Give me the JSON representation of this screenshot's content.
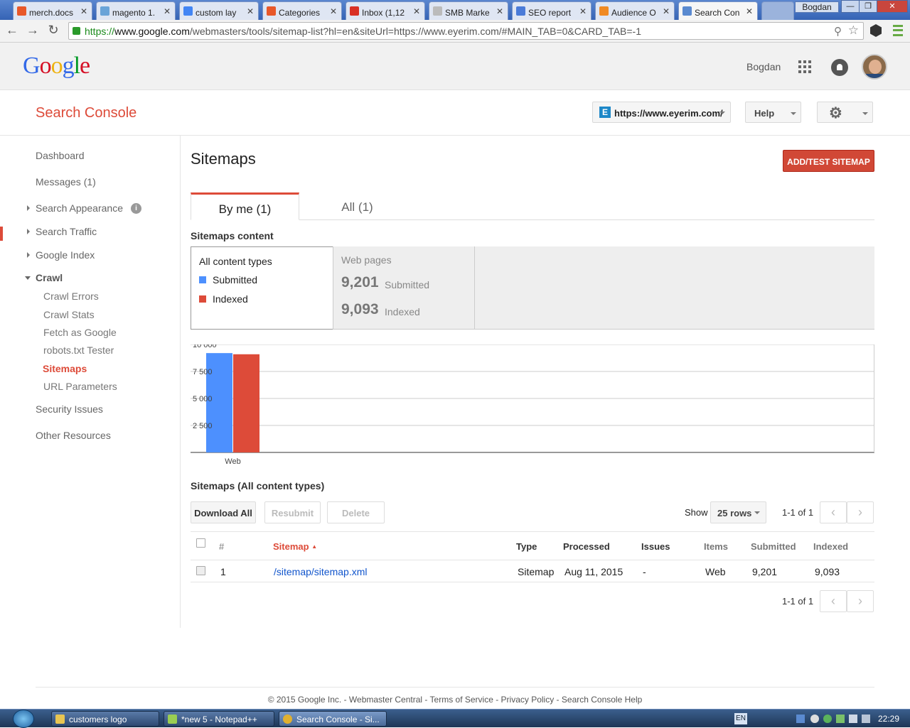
{
  "browser": {
    "tabs": [
      {
        "title": "merch.docs",
        "icon": "magento-icon",
        "color": "#e8582a"
      },
      {
        "title": "magento 1.",
        "icon": "magento-answers-icon",
        "color": "#6aa4d8"
      },
      {
        "title": "custom lay",
        "icon": "google-search-icon",
        "color": "#4285f4"
      },
      {
        "title": "Categories",
        "icon": "magento-icon",
        "color": "#e8582a"
      },
      {
        "title": "Inbox (1,12",
        "icon": "gmail-icon",
        "color": "#d93025"
      },
      {
        "title": "SMB Marke",
        "icon": "document-icon",
        "color": "#888888"
      },
      {
        "title": "SEO report",
        "icon": "google-docs-icon",
        "color": "#4a7bd8"
      },
      {
        "title": "Audience O",
        "icon": "analytics-icon",
        "color": "#f08a24"
      },
      {
        "title": "Search Con",
        "icon": "search-console-icon",
        "color": "#5a8ad0"
      }
    ],
    "window_user": "Bogdan",
    "window_controls": [
      "—",
      "❐",
      "✕"
    ],
    "url": {
      "scheme": "https://",
      "domain": "www.google.com",
      "path": "/webmasters/tools/sitemap-list?hl=en&siteUrl=https://www.eyerim.com/#MAIN_TAB=0&CARD_TAB=-1"
    },
    "nav_icons": [
      "back-icon",
      "forward-icon",
      "reload-icon"
    ]
  },
  "google_header": {
    "logo": "Google",
    "logo_colors": [
      "#3369e8",
      "#d50f25",
      "#eeb211",
      "#3369e8",
      "#009925",
      "#d50f25"
    ],
    "user_name": "Bogdan"
  },
  "console": {
    "title": "Search Console",
    "property": "https://www.eyerim.com/",
    "property_badge": "E",
    "help_label": "Help"
  },
  "sidebar": {
    "items": [
      {
        "label": "Dashboard"
      },
      {
        "label": "Messages (1)"
      },
      {
        "label": "Search Appearance"
      },
      {
        "label": "Search Traffic"
      },
      {
        "label": "Google Index"
      },
      {
        "label": "Crawl"
      },
      {
        "label": "Crawl Errors"
      },
      {
        "label": "Crawl Stats"
      },
      {
        "label": "Fetch as Google"
      },
      {
        "label": "robots.txt Tester"
      },
      {
        "label": "Sitemaps"
      },
      {
        "label": "URL Parameters"
      },
      {
        "label": "Security Issues"
      },
      {
        "label": "Other Resources"
      }
    ],
    "info_icon": "i"
  },
  "main": {
    "page_title": "Sitemaps",
    "add_button": "ADD/TEST SITEMAP",
    "tabs": [
      {
        "label": "By me (1)"
      },
      {
        "label": "All (1)"
      }
    ],
    "content_heading": "Sitemaps content",
    "legend": {
      "title": "All content types",
      "submitted": "Submitted",
      "indexed": "Indexed",
      "submitted_color": "#4d90fe",
      "indexed_color": "#dd4b39"
    },
    "stats": {
      "title": "Web pages",
      "submitted_value": "9,201",
      "submitted_label": "Submitted",
      "indexed_value": "9,093",
      "indexed_label": "Indexed"
    },
    "table_heading": "Sitemaps (All content types)",
    "actions": {
      "download": "Download All",
      "resubmit": "Resubmit",
      "delete": "Delete"
    },
    "show_label": "Show",
    "rows_select": "25 rows",
    "range_top": "1-1 of 1",
    "range_bottom": "1-1 of 1",
    "columns": [
      "#",
      "Sitemap",
      "Type",
      "Processed",
      "Issues",
      "Items",
      "Submitted",
      "Indexed"
    ],
    "sort_icon": "▲",
    "rows": [
      {
        "num": "1",
        "sitemap": "/sitemap/sitemap.xml",
        "type": "Sitemap",
        "processed": "Aug 11, 2015",
        "issues": "-",
        "items": "Web",
        "submitted": "9,201",
        "indexed": "9,093"
      }
    ]
  },
  "chart_data": {
    "type": "bar",
    "categories": [
      "Web"
    ],
    "series": [
      {
        "name": "Submitted",
        "values": [
          9201
        ],
        "color": "#4d90fe"
      },
      {
        "name": "Indexed",
        "values": [
          9093
        ],
        "color": "#dd4b39"
      }
    ],
    "yticks": [
      2500,
      5000,
      7500,
      10000
    ],
    "ytick_labels": [
      "2 500",
      "5 000",
      "7 500",
      "10 000"
    ],
    "ylim": [
      0,
      10000
    ],
    "grid": true
  },
  "footer": {
    "text": "© 2015 Google Inc. - Webmaster Central - Terms of Service - Privacy Policy - Search Console Help"
  },
  "taskbar": {
    "items": [
      {
        "label": "customers logo",
        "icon": "folder-icon",
        "color": "#e8c552"
      },
      {
        "label": "*new  5 - Notepad++",
        "icon": "notepad-icon",
        "color": "#9acd52"
      },
      {
        "label": "Search Console - Si...",
        "icon": "chrome-icon",
        "color": "#e0b030"
      }
    ],
    "lang": "EN",
    "clock": "22:29"
  }
}
